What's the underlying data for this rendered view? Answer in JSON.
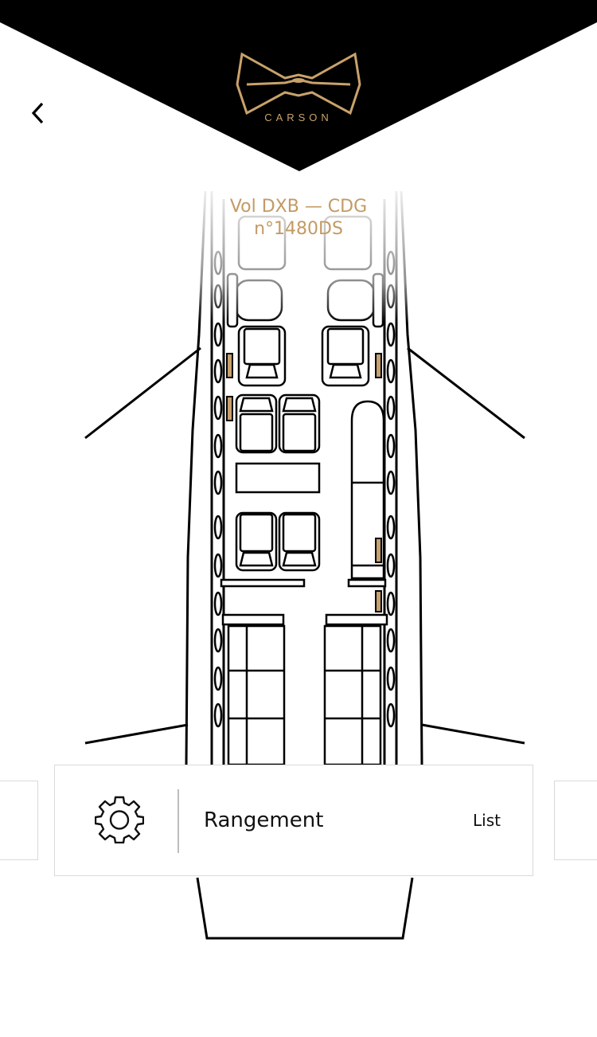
{
  "header": {
    "brand": "CARSON",
    "back_icon": "chevron-left-icon"
  },
  "flight": {
    "route": "Vol DXB — CDG",
    "number": "n°1480DS"
  },
  "card": {
    "icon": "gear-icon",
    "title": "Rangement",
    "action": "List"
  },
  "colors": {
    "gold": "#c39a64",
    "header_bg": "#000000",
    "seat_accent": "#c8a06e"
  }
}
